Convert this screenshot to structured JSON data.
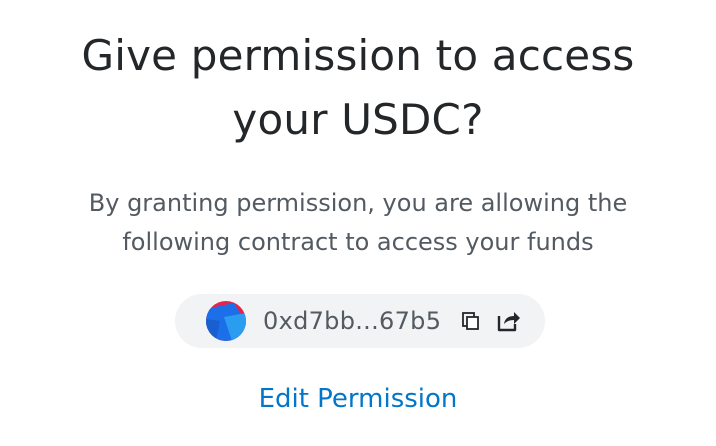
{
  "dialog": {
    "title_line1": "Give permission to access",
    "title_line2": "your USDC?",
    "description_line1": "By granting permission, you are allowing the",
    "description_line2": "following contract to access your funds",
    "contract": {
      "address": "0xd7bb...67b5",
      "avatar_icon": "jazzicon-avatar",
      "copy_icon": "copy-icon",
      "share_icon": "open-in-new-icon"
    },
    "edit_permission_label": "Edit Permission"
  },
  "colors": {
    "title": "#24272a",
    "description": "#535a61",
    "pill_background": "#f2f3f4",
    "link": "#0376c9",
    "avatar_red": "#e2254f",
    "avatar_blue": "#1c6fe8",
    "avatar_lightblue": "#2b9df0"
  }
}
